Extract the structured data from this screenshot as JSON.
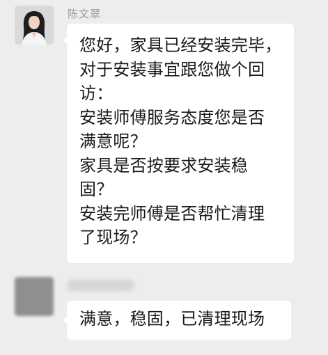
{
  "conversation": {
    "messages": [
      {
        "sender": "陈文翠",
        "lines": [
          "您好，家具已经安装完毕，",
          "对于安装事宜跟您做个回",
          "访：",
          "安装师傅服务态度您是否",
          "满意呢？",
          "家具是否按要求安装稳",
          "固？",
          "安装完师傅是否帮忙清理",
          "了现场？"
        ]
      },
      {
        "sender": "",
        "lines": [
          "满意，稳固，已清理现场"
        ]
      }
    ]
  },
  "colors": {
    "background": "#ededed",
    "bubble": "#ffffff",
    "text": "#1a1a1a",
    "sender_name": "#9a9a9a"
  }
}
